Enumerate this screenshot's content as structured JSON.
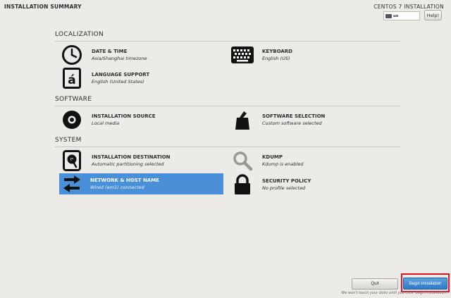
{
  "header": {
    "page_title": "INSTALLATION SUMMARY",
    "product_title": "CENTOS 7 INSTALLATION",
    "keyboard_layout": "us",
    "help_label": "Help!"
  },
  "sections": {
    "localization": {
      "title": "LOCALIZATION",
      "date_time": {
        "title": "DATE & TIME",
        "status": "Asia/Shanghai timezone",
        "icon": "clock-icon"
      },
      "keyboard": {
        "title": "KEYBOARD",
        "status": "English (US)",
        "icon": "keyboard-icon"
      },
      "language": {
        "title": "LANGUAGE SUPPORT",
        "status": "English (United States)",
        "icon": "language-icon"
      }
    },
    "software": {
      "title": "SOFTWARE",
      "source": {
        "title": "INSTALLATION SOURCE",
        "status": "Local media",
        "icon": "disc-icon"
      },
      "selection": {
        "title": "SOFTWARE SELECTION",
        "status": "Custom software selected",
        "icon": "package-icon"
      }
    },
    "system": {
      "title": "SYSTEM",
      "destination": {
        "title": "INSTALLATION DESTINATION",
        "status": "Automatic partitioning selected",
        "icon": "harddisk-icon"
      },
      "kdump": {
        "title": "KDUMP",
        "status": "Kdump is enabled",
        "icon": "magnifier-icon"
      },
      "network": {
        "title": "NETWORK & HOST NAME",
        "status": "Wired (em1) connected",
        "icon": "network-arrows-icon",
        "selected": true
      },
      "security": {
        "title": "SECURITY POLICY",
        "status": "No profile selected",
        "icon": "lock-icon"
      }
    }
  },
  "footer": {
    "quit_label": "Quit",
    "begin_label": "Begin Installation",
    "note": "We won't touch your disks until you click 'Begin Installation'."
  },
  "colors": {
    "background": "#edebe7",
    "selected": "#4a90d9",
    "begin_button": "#3a85cf",
    "highlight": "#e0142a"
  }
}
